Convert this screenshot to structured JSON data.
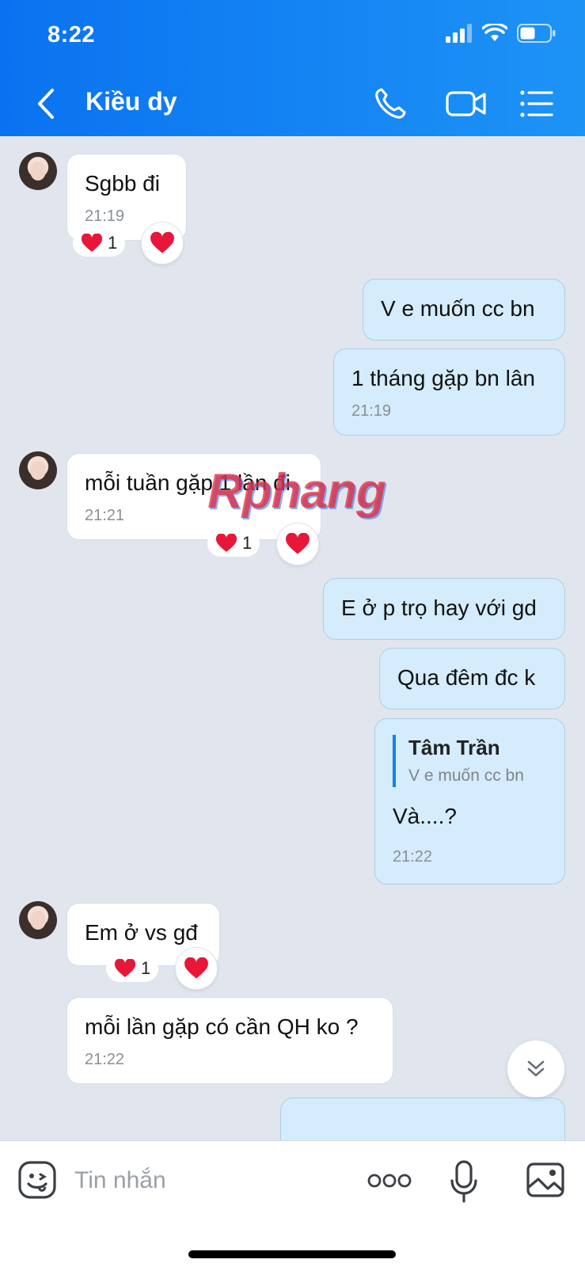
{
  "status": {
    "time": "8:22"
  },
  "header": {
    "title": "Kiều dy"
  },
  "messages": [
    {
      "text": "Sgbb đi",
      "time": "21:19",
      "reaction_count": "1"
    },
    {
      "text": "V e muốn cc bn"
    },
    {
      "text": "1 tháng gặp bn lân",
      "time": "21:19"
    },
    {
      "text": "mỗi tuần gặp 1 lần đi",
      "time": "21:21",
      "reaction_count": "1"
    },
    {
      "text": "E ở p trọ hay với gd"
    },
    {
      "text": "Qua đêm đc k"
    },
    {
      "quote_name": "Tâm Trần",
      "quote_text": "V e muốn cc bn",
      "text": "Và....?",
      "time": "21:22"
    },
    {
      "text": "Em ở vs gđ",
      "reaction_count": "1"
    },
    {
      "text": "mỗi lần gặp có cần QH ko ?",
      "time": "21:22"
    }
  ],
  "watermark": "Rphang",
  "composer": {
    "placeholder": "Tin nhắn"
  },
  "colors": {
    "header": "#0a72f0",
    "outgoing_bubble": "#d4ecfb",
    "background": "#e1e6ee"
  }
}
